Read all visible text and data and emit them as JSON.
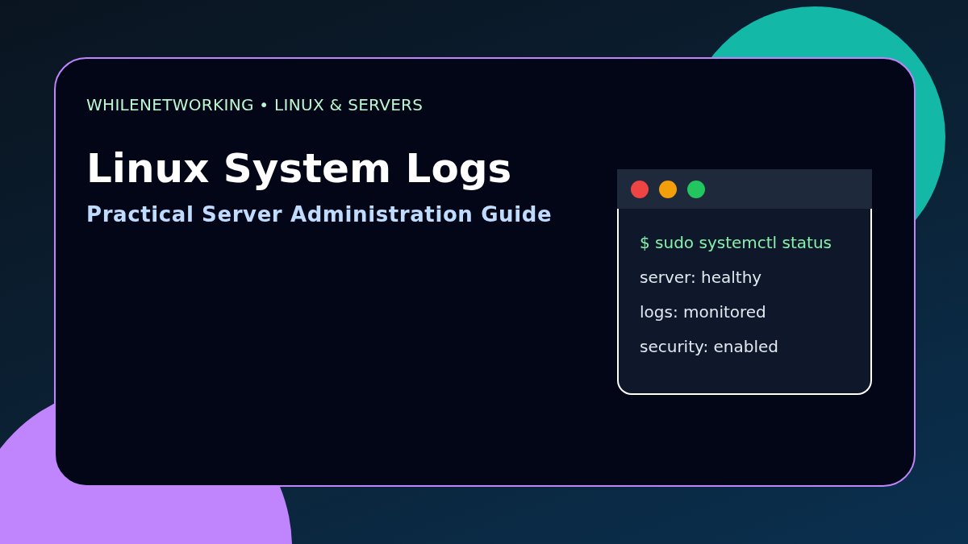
{
  "eyebrow": "WHILENETWORKING • LINUX & SERVERS",
  "title": "Linux System Logs",
  "subtitle": "Practical Server Administration Guide",
  "terminal": {
    "lines": [
      {
        "kind": "command",
        "text": "$ sudo systemctl status"
      },
      {
        "kind": "output",
        "text": "server: healthy"
      },
      {
        "kind": "output",
        "text": "logs: monitored"
      },
      {
        "kind": "output",
        "text": "security: enabled"
      }
    ]
  }
}
